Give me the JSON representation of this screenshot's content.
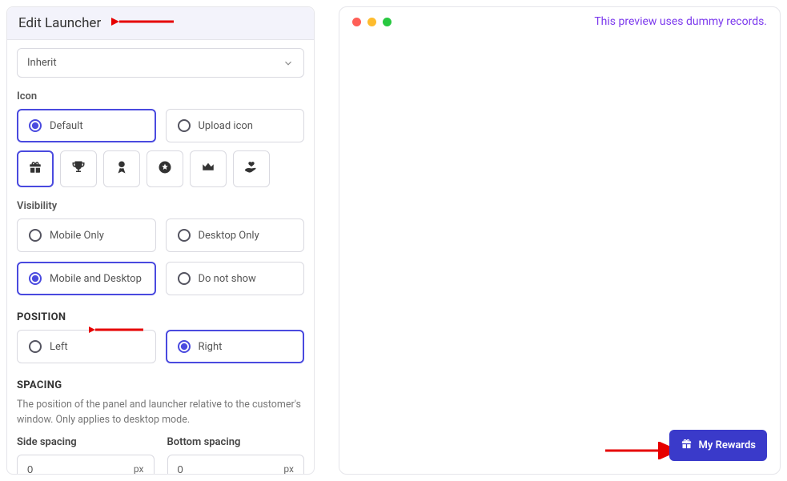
{
  "panel_title": "Edit Launcher",
  "select_value": "Inherit",
  "icon_section": {
    "label": "Icon",
    "default_label": "Default",
    "upload_label": "Upload icon"
  },
  "visibility": {
    "label": "Visibility",
    "options": [
      "Mobile Only",
      "Desktop Only",
      "Mobile and Desktop",
      "Do not show"
    ]
  },
  "position": {
    "heading": "POSITION",
    "left_label": "Left",
    "right_label": "Right"
  },
  "spacing": {
    "heading": "SPACING",
    "desc": "The position of the panel and launcher relative to the customer's window. Only applies to desktop mode.",
    "side_label": "Side spacing",
    "bottom_label": "Bottom spacing",
    "side_value": "0",
    "bottom_value": "0",
    "unit": "px"
  },
  "preview": {
    "message": "This preview uses dummy records.",
    "launcher_label": "My Rewards"
  }
}
